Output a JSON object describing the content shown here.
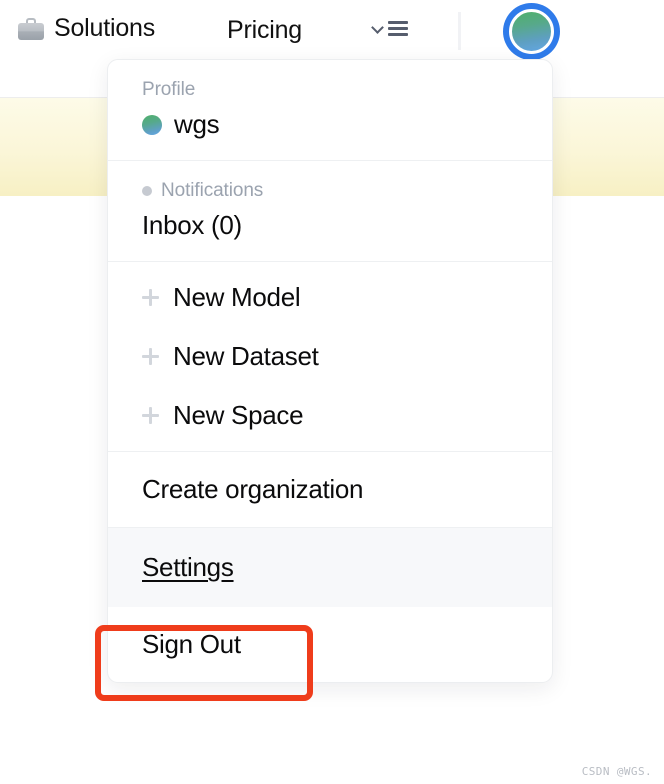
{
  "topbar": {
    "solutions_label": "Solutions",
    "pricing_label": "Pricing",
    "briefcase_icon": "briefcase-icon",
    "chevron_icon": "chevron-down-icon",
    "hamburger_icon": "hamburger-menu-icon",
    "avatar_alt": "user-avatar"
  },
  "dropdown": {
    "profile": {
      "section_label": "Profile",
      "username": "wgs"
    },
    "notifications": {
      "section_label": "Notifications",
      "inbox_label": "Inbox (0)"
    },
    "create_items": [
      {
        "label": "New Model",
        "icon": "plus-icon"
      },
      {
        "label": "New Dataset",
        "icon": "plus-icon"
      },
      {
        "label": "New Space",
        "icon": "plus-icon"
      }
    ],
    "organization": {
      "create_org_label": "Create organization"
    },
    "account": {
      "settings_label": "Settings",
      "sign_out_label": "Sign Out"
    }
  },
  "annotation": {
    "target": "Settings",
    "color": "#ef3c1b"
  },
  "watermark": {
    "text": "CSDN @WGS."
  },
  "colors": {
    "banner": "#fbf6d8",
    "accent_blue": "#2f7bea",
    "highlight_red": "#ef3c1b",
    "row_hover": "#f7f8fa"
  }
}
